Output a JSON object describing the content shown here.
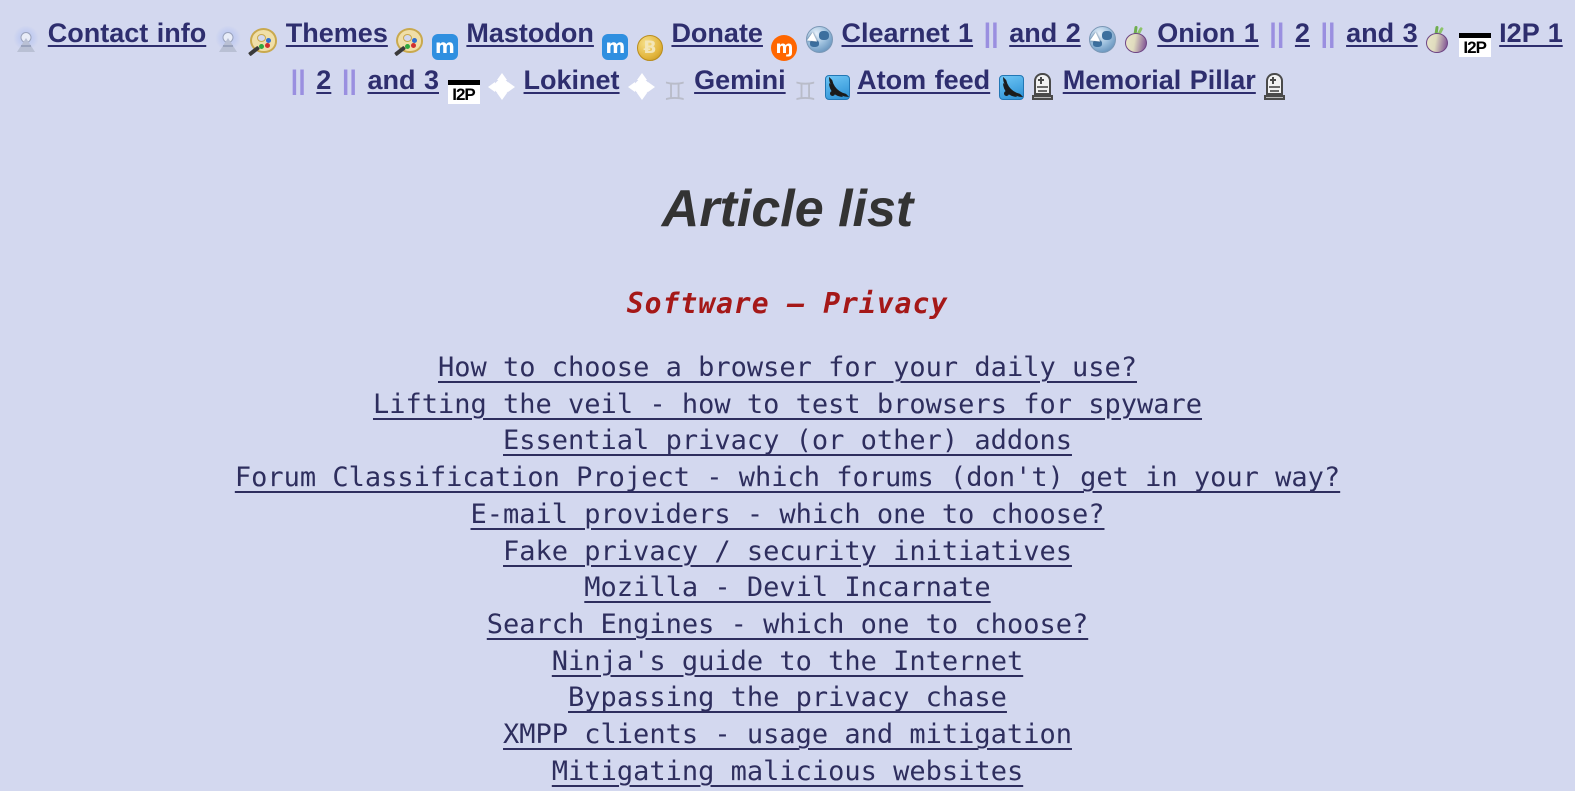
{
  "topnav": {
    "items": [
      {
        "type": "icon",
        "icon": "antenna-tower-icon"
      },
      {
        "type": "link",
        "label": "Contact info",
        "name": "nav-link-contact-info"
      },
      {
        "type": "icon",
        "icon": "antenna-tower-icon"
      },
      {
        "type": "icon",
        "icon": "palette-icon"
      },
      {
        "type": "link",
        "label": "Themes",
        "name": "nav-link-themes"
      },
      {
        "type": "icon",
        "icon": "palette-icon"
      },
      {
        "type": "icon",
        "icon": "mastodon-icon",
        "glyph": "m"
      },
      {
        "type": "link",
        "label": "Mastodon",
        "name": "nav-link-mastodon"
      },
      {
        "type": "icon",
        "icon": "mastodon-icon",
        "glyph": "m"
      },
      {
        "type": "icon",
        "icon": "bitcoin-icon",
        "glyph": "Ƀ"
      },
      {
        "type": "link",
        "label": "Donate",
        "name": "nav-link-donate"
      },
      {
        "type": "icon",
        "icon": "monero-icon",
        "glyph": "ɱ"
      },
      {
        "type": "icon",
        "icon": "globe-cursor-icon"
      },
      {
        "type": "link",
        "label": "Clearnet 1",
        "name": "nav-link-clearnet-1"
      },
      {
        "type": "sep",
        "label": "||"
      },
      {
        "type": "link",
        "label": "and 2",
        "name": "nav-link-clearnet-2"
      },
      {
        "type": "icon",
        "icon": "globe-cursor-icon"
      },
      {
        "type": "icon",
        "icon": "onion-icon"
      },
      {
        "type": "link",
        "label": "Onion 1",
        "name": "nav-link-onion-1"
      },
      {
        "type": "sep",
        "label": "||"
      },
      {
        "type": "link",
        "label": "2",
        "name": "nav-link-onion-2"
      },
      {
        "type": "sep",
        "label": "||"
      },
      {
        "type": "link",
        "label": "and 3",
        "name": "nav-link-onion-3"
      },
      {
        "type": "icon",
        "icon": "onion-icon"
      },
      {
        "type": "icon",
        "icon": "i2p-icon",
        "glyph": "I2P"
      },
      {
        "type": "link",
        "label": "I2P 1",
        "name": "nav-link-i2p-1"
      },
      {
        "type": "sep",
        "label": "||"
      },
      {
        "type": "link",
        "label": "2",
        "name": "nav-link-i2p-2"
      },
      {
        "type": "sep",
        "label": "||"
      },
      {
        "type": "link",
        "label": "and 3",
        "name": "nav-link-i2p-3"
      },
      {
        "type": "icon",
        "icon": "i2p-icon",
        "glyph": "I2P"
      },
      {
        "type": "icon",
        "icon": "lokinet-icon"
      },
      {
        "type": "link",
        "label": "Lokinet",
        "name": "nav-link-lokinet"
      },
      {
        "type": "icon",
        "icon": "lokinet-icon"
      },
      {
        "type": "icon",
        "icon": "gemini-icon",
        "glyph": "♊"
      },
      {
        "type": "link",
        "label": "Gemini",
        "name": "nav-link-gemini"
      },
      {
        "type": "icon",
        "icon": "gemini-icon",
        "glyph": "♊"
      },
      {
        "type": "icon",
        "icon": "rss-feed-icon"
      },
      {
        "type": "link",
        "label": "Atom feed",
        "name": "nav-link-atom-feed"
      },
      {
        "type": "icon",
        "icon": "rss-feed-icon"
      },
      {
        "type": "icon",
        "icon": "tombstone-icon"
      },
      {
        "type": "link",
        "label": "Memorial Pillar",
        "name": "nav-link-memorial-pillar"
      },
      {
        "type": "icon",
        "icon": "tombstone-icon"
      }
    ]
  },
  "main": {
    "title": "Article list",
    "subtitle": "Software — Privacy",
    "articles": [
      "How to choose a browser for your daily use?",
      "Lifting the veil - how to test browsers for spyware",
      "Essential privacy (or other) addons",
      "Forum Classification Project - which forums (don't) get in your way?",
      "E-mail providers - which one to choose?",
      "Fake privacy / security initiatives",
      "Mozilla - Devil Incarnate",
      "Search Engines - which one to choose?",
      "Ninja's guide to the Internet",
      "Bypassing the privacy chase",
      "XMPP clients - usage and mitigation",
      "Mitigating malicious websites"
    ]
  },
  "colors": {
    "background": "#d3d8ef",
    "nav_link": "#2e2e6e",
    "separator": "#9a8fe0",
    "title": "#333333",
    "subtitle": "#a51818",
    "article_link": "#2e2e5e"
  }
}
